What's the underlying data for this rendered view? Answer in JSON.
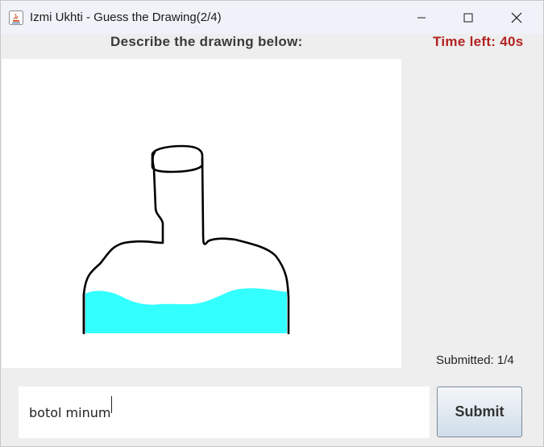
{
  "window": {
    "title": "Izmi Ukhti - Guess the Drawing(2/4)"
  },
  "game": {
    "prompt": "Describe the drawing below:",
    "timer": "Time left: 40s",
    "submitted": "Submitted: 1/4"
  },
  "answer": {
    "value": "botol minum"
  },
  "submit": {
    "label": "Submit"
  },
  "colors": {
    "timer": "#b22222",
    "water": "#33ffff",
    "stroke": "#000000"
  },
  "icons": [
    "java-app-icon",
    "minimize-icon",
    "maximize-icon",
    "close-icon"
  ]
}
